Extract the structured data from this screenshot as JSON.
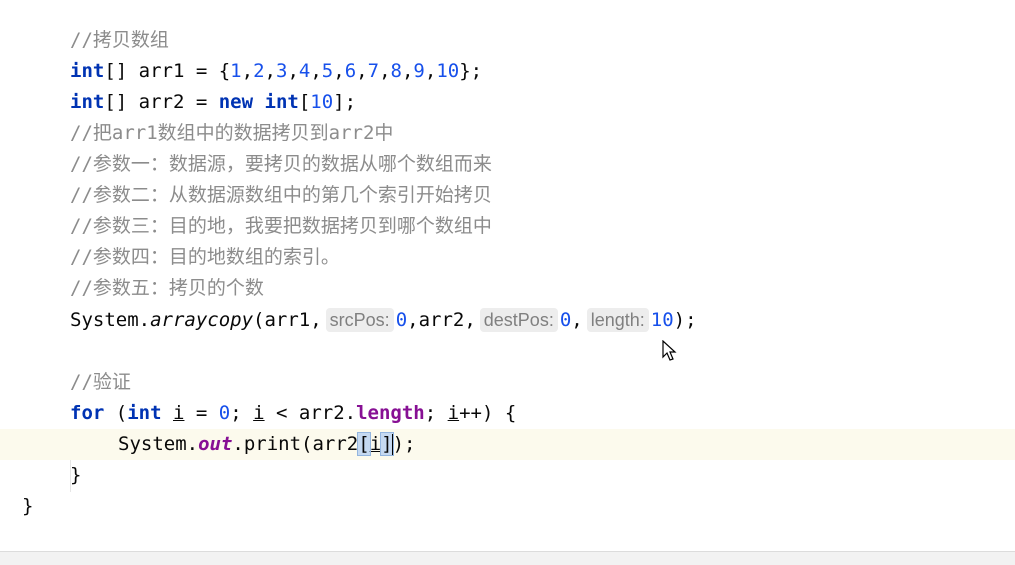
{
  "editor": {
    "lines": {
      "l1": {
        "comment": "//拷贝数组"
      },
      "l2": {
        "kw_int": "int",
        "t1": "[] arr1 = {",
        "nums": [
          "1",
          "2",
          "3",
          "4",
          "5",
          "6",
          "7",
          "8",
          "9",
          "10"
        ],
        "t2": "};"
      },
      "l3": {
        "kw_int": "int",
        "t1": "[] arr2 = ",
        "kw_new": "new",
        "kw_int2": "int",
        "t2": "[",
        "n": "10",
        "t3": "];"
      },
      "l4": {
        "comment": "//把arr1数组中的数据拷贝到arr2中"
      },
      "l5": {
        "comment": "//参数一：数据源，要拷贝的数据从哪个数组而来"
      },
      "l6": {
        "comment": "//参数二：从数据源数组中的第几个索引开始拷贝"
      },
      "l7": {
        "comment": "//参数三：目的地，我要把数据拷贝到哪个数组中"
      },
      "l8": {
        "comment": "//参数四：目的地数组的索引。"
      },
      "l9": {
        "comment": "//参数五：拷贝的个数"
      },
      "l10": {
        "sys": "System.",
        "method": "arraycopy",
        "t1": "(arr1,",
        "hint1": "srcPos:",
        "n1": "0",
        "t2": ",arr2,",
        "hint2": "destPos:",
        "n2": "0",
        "t3": ",",
        "hint3": "length:",
        "n3": "10",
        "t4": ");"
      },
      "l12": {
        "comment": "//验证"
      },
      "l13": {
        "kw_for": "for",
        "t1": " (",
        "kw_int": "int",
        "sp": " ",
        "i1": "i",
        "t2": " = ",
        "n": "0",
        "t3": "; ",
        "i2": "i",
        "t4": " < arr2.",
        "prop": "length",
        "t5": "; ",
        "i3": "i",
        "t6": "++) {"
      },
      "l14": {
        "sys": "System.",
        "field": "out",
        "t1": ".print(arr2",
        "lb": "[",
        "i": "i",
        "rb": "]",
        "t2": ");"
      },
      "l15": {
        "brace": "}"
      },
      "l16": {
        "brace": "}"
      }
    }
  }
}
